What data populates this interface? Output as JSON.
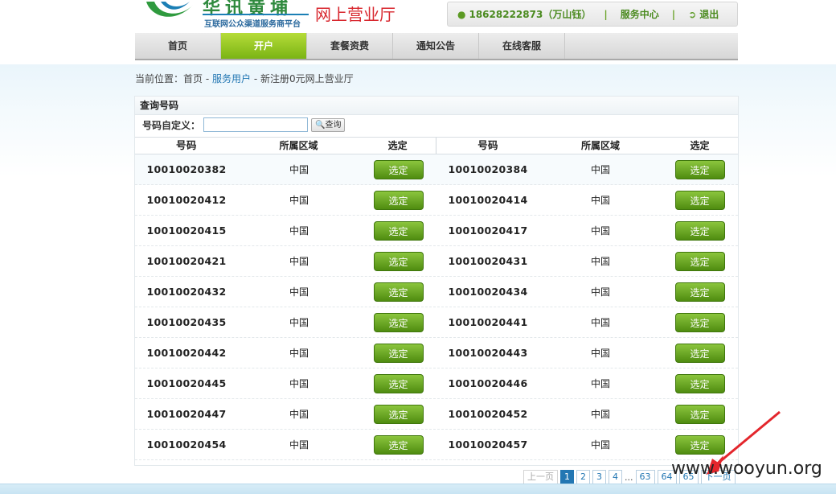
{
  "header": {
    "logo_main": "华讯黄埔",
    "logo_sub": "互联网公众渠道服务商平台",
    "logo_hall": "网上营业厅"
  },
  "userbar": {
    "user_label": "18628222873（万山钰）",
    "service_center": "服务中心",
    "logout": "退出"
  },
  "nav": {
    "items": [
      "首页",
      "开户",
      "套餐资费",
      "通知公告",
      "在线客服"
    ]
  },
  "breadcrumb": {
    "prefix": "当前位置：",
    "home": "首页",
    "sep": " - ",
    "service_users": "服务用户",
    "current": "新注册0元网上营业厅"
  },
  "panel": {
    "title": "查询号码",
    "search_label": "号码自定义：",
    "search_value": "",
    "search_button": "查询"
  },
  "table": {
    "headers": [
      "号码",
      "所属区域",
      "选定"
    ],
    "select_label": "选定",
    "rows": [
      [
        {
          "number": "10010020382",
          "region": "中国"
        },
        {
          "number": "10010020384",
          "region": "中国"
        }
      ],
      [
        {
          "number": "10010020412",
          "region": "中国"
        },
        {
          "number": "10010020414",
          "region": "中国"
        }
      ],
      [
        {
          "number": "10010020415",
          "region": "中国"
        },
        {
          "number": "10010020417",
          "region": "中国"
        }
      ],
      [
        {
          "number": "10010020421",
          "region": "中国"
        },
        {
          "number": "10010020431",
          "region": "中国"
        }
      ],
      [
        {
          "number": "10010020432",
          "region": "中国"
        },
        {
          "number": "10010020434",
          "region": "中国"
        }
      ],
      [
        {
          "number": "10010020435",
          "region": "中国"
        },
        {
          "number": "10010020441",
          "region": "中国"
        }
      ],
      [
        {
          "number": "10010020442",
          "region": "中国"
        },
        {
          "number": "10010020443",
          "region": "中国"
        }
      ],
      [
        {
          "number": "10010020445",
          "region": "中国"
        },
        {
          "number": "10010020446",
          "region": "中国"
        }
      ],
      [
        {
          "number": "10010020447",
          "region": "中国"
        },
        {
          "number": "10010020452",
          "region": "中国"
        }
      ],
      [
        {
          "number": "10010020454",
          "region": "中国"
        },
        {
          "number": "10010020457",
          "region": "中国"
        }
      ]
    ]
  },
  "pagination": {
    "prev": "上一页",
    "pages": [
      "1",
      "2",
      "3",
      "4"
    ],
    "ellipsis": "...",
    "tail_pages": [
      "63",
      "64",
      "65"
    ],
    "next": "下一页",
    "current": "1"
  },
  "watermark": "www.wooyun.org",
  "colors": {
    "accent_green": "#7ab414",
    "button_green": "#5a9a16",
    "link_blue": "#2377b3",
    "hall_red": "#d8262d",
    "arrow_red": "#e3262c"
  }
}
